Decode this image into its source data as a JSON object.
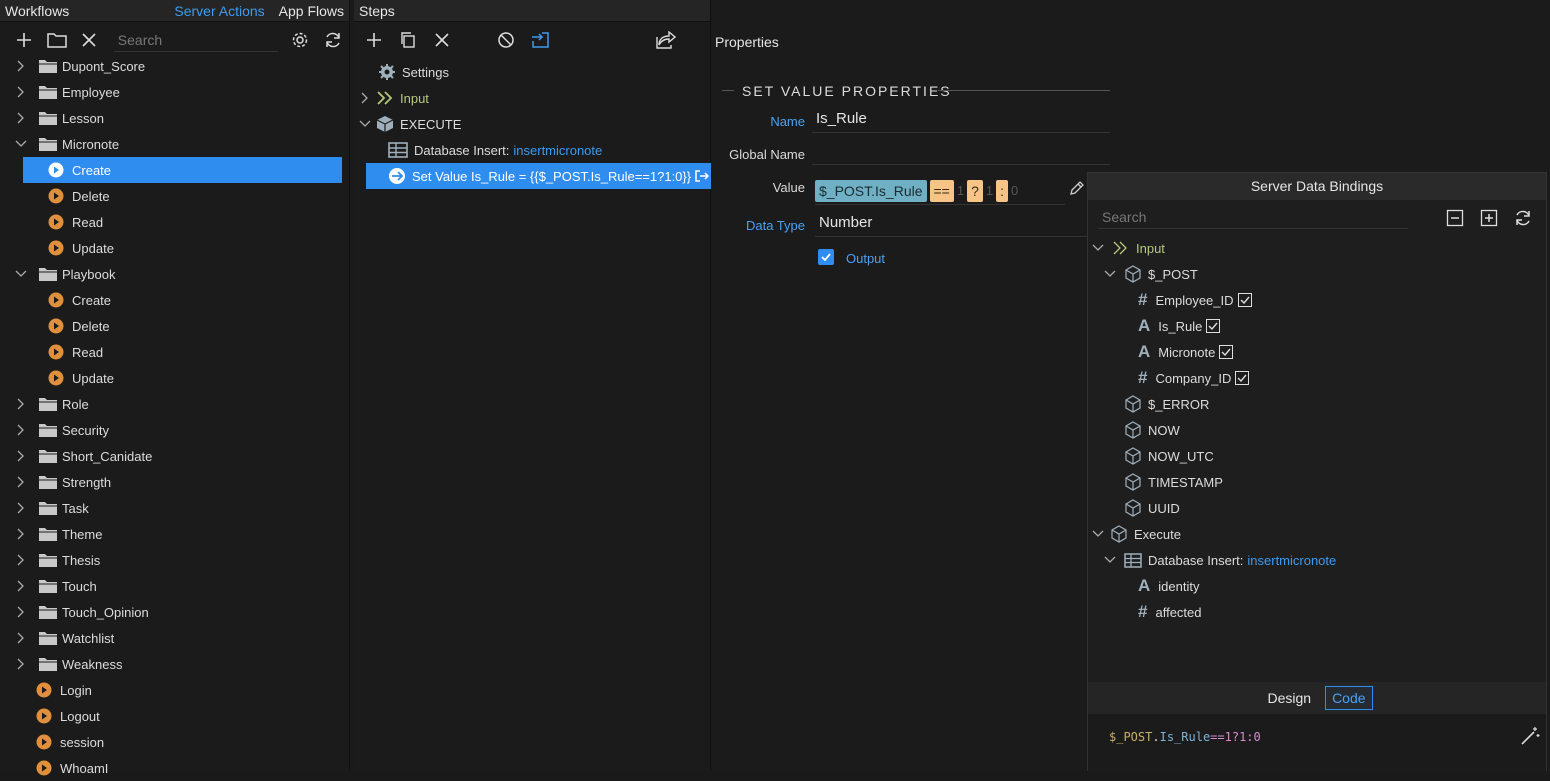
{
  "workflows": {
    "title": "Workflows",
    "server_actions": "Server Actions",
    "app_flows": "App Flows",
    "search_placeholder": "Search",
    "items": [
      {
        "label": "Dupont_Score",
        "type": "folder",
        "expanded": false
      },
      {
        "label": "Employee",
        "type": "folder",
        "expanded": false
      },
      {
        "label": "Lesson",
        "type": "folder",
        "expanded": false
      },
      {
        "label": "Micronote",
        "type": "folder",
        "expanded": true
      },
      {
        "label": "Create",
        "type": "action",
        "active": true
      },
      {
        "label": "Delete",
        "type": "action"
      },
      {
        "label": "Read",
        "type": "action"
      },
      {
        "label": "Update",
        "type": "action"
      },
      {
        "label": "Playbook",
        "type": "folder",
        "expanded": true
      },
      {
        "label": "Create",
        "type": "action"
      },
      {
        "label": "Delete",
        "type": "action"
      },
      {
        "label": "Read",
        "type": "action"
      },
      {
        "label": "Update",
        "type": "action"
      },
      {
        "label": "Role",
        "type": "folder"
      },
      {
        "label": "Security",
        "type": "folder"
      },
      {
        "label": "Short_Canidate",
        "type": "folder"
      },
      {
        "label": "Strength",
        "type": "folder"
      },
      {
        "label": "Task",
        "type": "folder"
      },
      {
        "label": "Theme",
        "type": "folder"
      },
      {
        "label": "Thesis",
        "type": "folder"
      },
      {
        "label": "Touch",
        "type": "folder"
      },
      {
        "label": "Touch_Opinion",
        "type": "folder"
      },
      {
        "label": "Watchlist",
        "type": "folder"
      },
      {
        "label": "Weakness",
        "type": "folder"
      },
      {
        "label": "Login",
        "type": "root-action"
      },
      {
        "label": "Logout",
        "type": "root-action"
      },
      {
        "label": "session",
        "type": "root-action"
      },
      {
        "label": "WhoamI",
        "type": "root-action"
      }
    ]
  },
  "steps": {
    "title": "Steps",
    "settings": "Settings",
    "input": "Input",
    "execute": "EXECUTE",
    "db_insert_prefix": "Database Insert:",
    "db_insert_name": "insertmicronote",
    "set_value": "Set Value Is_Rule = {{$_POST.Is_Rule==1?1:0}}"
  },
  "properties": {
    "title": "Properties",
    "section": "SET VALUE PROPERTIES",
    "name_label": "Name",
    "name_value": "Is_Rule",
    "global_label": "Global Name",
    "global_value": "",
    "value_label": "Value",
    "value_chip1": "$_POST.Is_Rule",
    "value_chip2": "==",
    "value_v1": "1",
    "value_chip3": "?",
    "value_v2": "1",
    "value_chip4": ":",
    "value_v3": "0",
    "datatype_label": "Data Type",
    "datatype_value": "Number",
    "output_label": "Output"
  },
  "bindings": {
    "title": "Server Data Bindings",
    "search_placeholder": "Search",
    "input": "Input",
    "post": "$_POST",
    "employee_id": "Employee_ID",
    "is_rule": "Is_Rule",
    "micronote": "Micronote",
    "company_id": "Company_ID",
    "error": "$_ERROR",
    "now": "NOW",
    "now_utc": "NOW_UTC",
    "timestamp": "TIMESTAMP",
    "uuid": "UUID",
    "execute": "Execute",
    "db_prefix": "Database Insert:",
    "db_name": "insertmicronote",
    "identity": "identity",
    "affected": "affected",
    "tab_design": "Design",
    "tab_code": "Code",
    "code_var": "$_POST",
    "code_dot": ".",
    "code_prop": "Is_Rule",
    "code_rest": "==1?1:0"
  },
  "colors": {
    "accent": "#2f8df0",
    "chip_blue": "#6fb0c4",
    "chip_orange": "#f5c486",
    "input_green": "#b5c97a",
    "folder": "#c8c8c8",
    "play": "#e0903b",
    "cube": "#9fb0bc"
  }
}
